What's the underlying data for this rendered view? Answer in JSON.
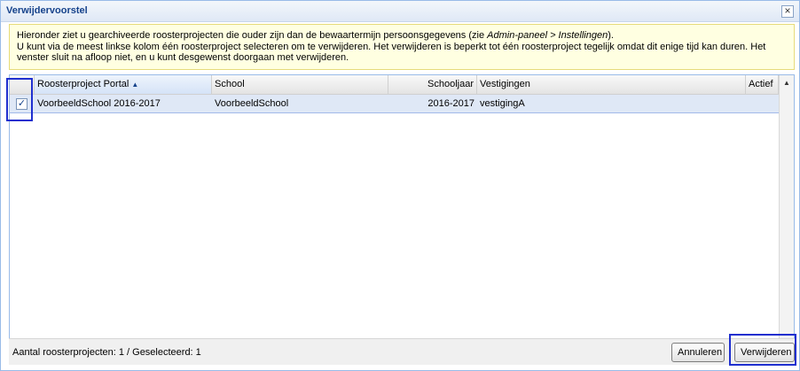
{
  "window": {
    "title": "Verwijdervoorstel",
    "close_symbol": "×"
  },
  "info": {
    "line1_pre": "Hieronder ziet u gearchiveerde roosterprojecten die ouder zijn dan de bewaartermijn persoonsgegevens (zie ",
    "line1_em": "Admin-paneel > Instellingen",
    "line1_post": ").",
    "line2": "U kunt via de meest linkse kolom één roosterproject selecteren om te verwijderen. Het verwijderen is beperkt tot één roosterproject tegelijk omdat dit enige tijd kan duren. Het",
    "line3": "venster sluit na afloop niet, en u kunt desgewenst doorgaan met verwijderen."
  },
  "grid": {
    "columns": {
      "project": "Roosterproject Portal",
      "school": "School",
      "year": "Schooljaar",
      "locations": "Vestigingen",
      "active": "Actief"
    },
    "rows": [
      {
        "checked": "✓",
        "project": "VoorbeeldSchool 2016-2017",
        "school": "VoorbeeldSchool",
        "year": "2016-2017",
        "locations": "vestigingA",
        "active": ""
      }
    ]
  },
  "footer": {
    "count_text": "Aantal roosterprojecten: 1 / Geselecteerd: 1",
    "cancel_label": "Annuleren",
    "delete_label": "Verwijderen"
  },
  "colors": {
    "highlight": "#1f2fcf",
    "selected_row": "#dfe8f6",
    "info_bg": "#ffffe1"
  }
}
